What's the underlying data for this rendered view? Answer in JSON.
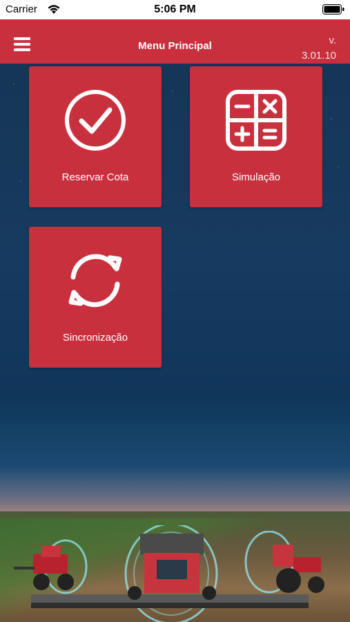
{
  "status_bar": {
    "carrier": "Carrier",
    "time": "5:06 PM"
  },
  "header": {
    "title": "Menu Principal",
    "version_prefix": "v.",
    "version_number": "3.01.10"
  },
  "menu": {
    "tiles": [
      {
        "label": "Reservar Cota",
        "icon": "check-circle-icon"
      },
      {
        "label": "Simulação",
        "icon": "calculator-icon"
      },
      {
        "label": "Sincronização",
        "icon": "sync-icon"
      }
    ]
  },
  "colors": {
    "brand_red": "#c9303e",
    "background_navy": "#153656"
  }
}
